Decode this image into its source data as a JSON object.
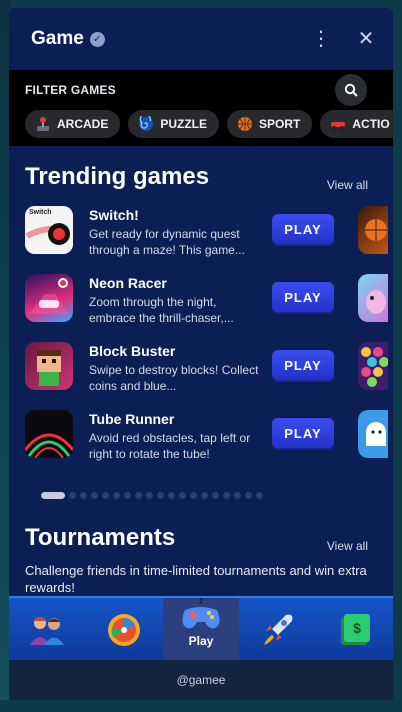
{
  "header": {
    "title": "Game"
  },
  "filter": {
    "label": "FILTER GAMES",
    "chips": [
      {
        "label": "ARCADE",
        "icon": "joystick-icon"
      },
      {
        "label": "PUZZLE",
        "icon": "spiral-icon"
      },
      {
        "label": "SPORT",
        "icon": "basketball-icon"
      },
      {
        "label": "ACTIO",
        "icon": "car-icon"
      }
    ]
  },
  "trending": {
    "title": "Trending games",
    "view_all": "View all",
    "games": [
      {
        "name": "Switch!",
        "desc": "Get ready for dynamic quest through a maze! This game...",
        "play": "PLAY",
        "thumb_text": "Switch"
      },
      {
        "name": "Neon Racer",
        "desc": "Zoom through the night, embrace the thrill-chaser,...",
        "play": "PLAY"
      },
      {
        "name": "Block Buster",
        "desc": "Swipe to destroy blocks! Collect coins and blue...",
        "play": "PLAY"
      },
      {
        "name": "Tube Runner",
        "desc": "Avoid red obstacles, tap left or right to rotate the tube!",
        "play": "PLAY"
      }
    ]
  },
  "tournaments": {
    "title": "Tournaments",
    "view_all": "View all",
    "desc": "Challenge friends in time-limited tournaments and win extra rewards!"
  },
  "nav": {
    "play_label": "Play"
  },
  "footer": {
    "text": "@gamee"
  },
  "colors": {
    "panel": "#0b1f54",
    "play_button": "#2f40e0",
    "nav": "#1555c9"
  }
}
